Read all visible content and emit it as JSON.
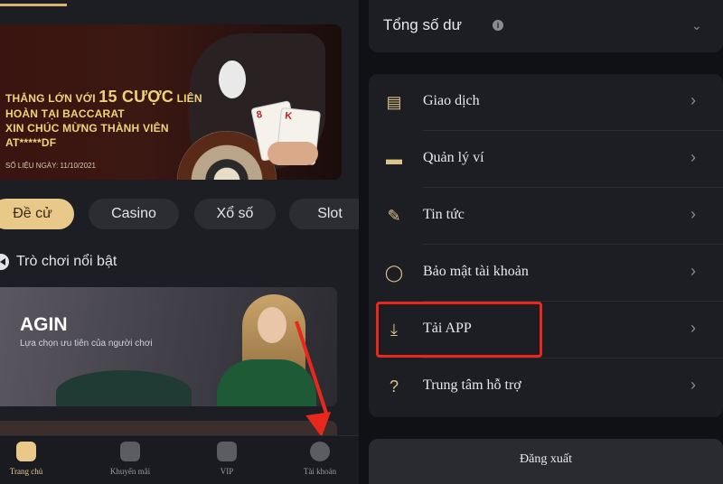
{
  "left": {
    "banner": {
      "line1_prefix": "THẮNG LỚN VỚI",
      "line1_big": "15 CƯỢC",
      "line1_suffix": "LIÊN",
      "line2": "HOÀN TẠI BACCARAT",
      "line3": "XIN CHÚC MỪNG THÀNH VIÊN",
      "line4": "AT*****DF",
      "date": "SỐ LIỆU NGÀY: 11/10/2021",
      "card1": "8",
      "card2": "K"
    },
    "chips": [
      {
        "label": "Đề cử",
        "active": true
      },
      {
        "label": "Casino",
        "active": false
      },
      {
        "label": "Xổ số",
        "active": false
      },
      {
        "label": "Slot",
        "active": false
      }
    ],
    "section_title": "Trò chơi nổi bật",
    "agin": {
      "title": "AGIN",
      "subtitle": "Lựa chọn ưu tiên của người chơi"
    },
    "bottom_nav": [
      {
        "label": "Trang chủ",
        "icon": "home-icon",
        "active": true
      },
      {
        "label": "Khuyến mãi",
        "icon": "gift-icon",
        "active": false
      },
      {
        "label": "VIP",
        "icon": "diamond-icon",
        "active": false
      },
      {
        "label": "Tài khoản",
        "icon": "account-icon",
        "active": false
      }
    ]
  },
  "right": {
    "balance_label": "Tổng số dư",
    "info_glyph": "i",
    "menu": [
      {
        "label": "Giao dịch",
        "icon": "receipt-icon"
      },
      {
        "label": "Quản lý ví",
        "icon": "wallet-icon"
      },
      {
        "label": "Tin tức",
        "icon": "news-icon"
      },
      {
        "label": "Bảo mật tài khoản",
        "icon": "shield-icon"
      },
      {
        "label": "Tải APP",
        "icon": "download-icon"
      },
      {
        "label": "Trung tâm hỗ trợ",
        "icon": "help-icon"
      }
    ],
    "logout_label": "Đăng xuất"
  },
  "colors": {
    "accent": "#e9c98a",
    "annotation_red": "#e8281c",
    "panel": "#1d1e23"
  }
}
